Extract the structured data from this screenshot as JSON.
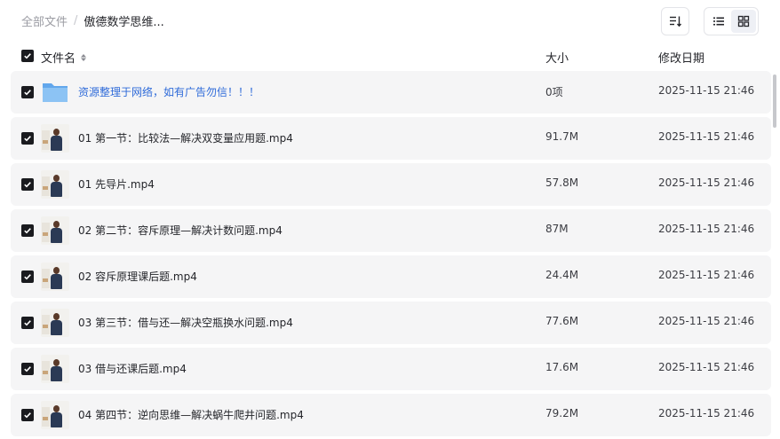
{
  "breadcrumb": {
    "root": "全部文件",
    "separator": "/",
    "current": "傲德数学思维..."
  },
  "toolbar": {
    "sort_icon": "sort-lines-icon",
    "view_list_icon": "list-view-icon",
    "view_grid_icon": "grid-view-icon",
    "active_view": "list"
  },
  "columns": {
    "name": "文件名",
    "size": "大小",
    "date": "修改日期"
  },
  "colors": {
    "folder_link": "#2f6bd9",
    "row_bg": "#f5f5f6",
    "checkbox": "#1a1b1f",
    "folder_icon": "#7fb8f0"
  },
  "files": [
    {
      "type": "folder",
      "name": "资源整理于网络，如有广告勿信！！！",
      "size": "0项",
      "date": "2025-11-15 21:46",
      "checked": true
    },
    {
      "type": "video",
      "name": "01 第一节：比较法—解决双变量应用题.mp4",
      "size": "91.7M",
      "date": "2025-11-15 21:46",
      "checked": true
    },
    {
      "type": "video",
      "name": "01 先导片.mp4",
      "size": "57.8M",
      "date": "2025-11-15 21:46",
      "checked": true
    },
    {
      "type": "video",
      "name": "02 第二节：容斥原理—解决计数问题.mp4",
      "size": "87M",
      "date": "2025-11-15 21:46",
      "checked": true
    },
    {
      "type": "video",
      "name": "02 容斥原理课后题.mp4",
      "size": "24.4M",
      "date": "2025-11-15 21:46",
      "checked": true
    },
    {
      "type": "video",
      "name": "03 第三节：借与还—解决空瓶换水问题.mp4",
      "size": "77.6M",
      "date": "2025-11-15 21:46",
      "checked": true
    },
    {
      "type": "video",
      "name": "03 借与还课后题.mp4",
      "size": "17.6M",
      "date": "2025-11-15 21:46",
      "checked": true
    },
    {
      "type": "video",
      "name": "04 第四节：逆向思维—解决蜗牛爬井问题.mp4",
      "size": "79.2M",
      "date": "2025-11-15 21:46",
      "checked": true
    }
  ]
}
